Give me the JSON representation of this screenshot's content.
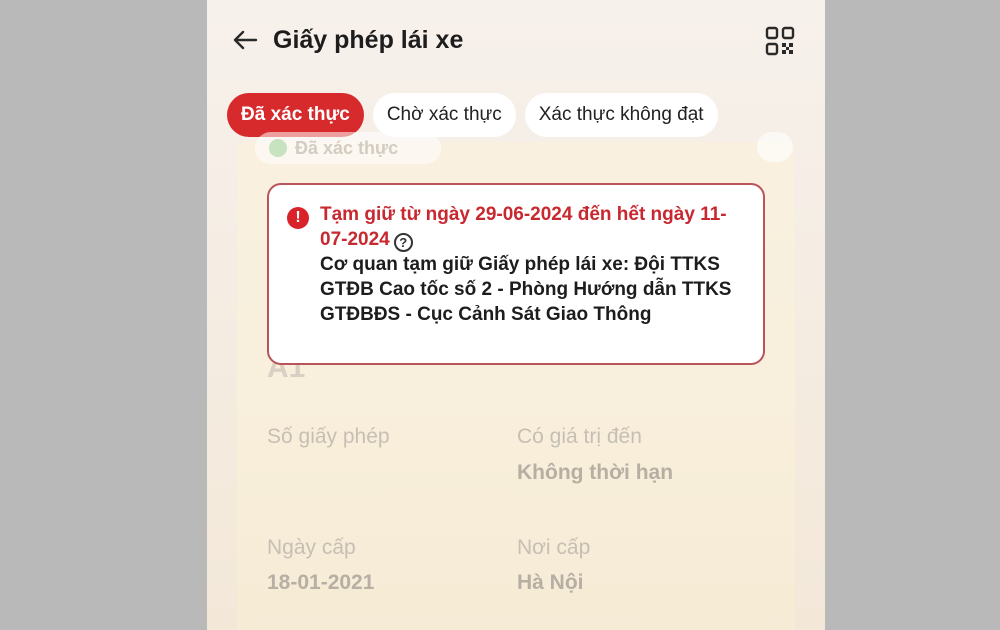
{
  "header": {
    "title": "Giấy phép lái xe",
    "back_icon": "arrow-left-icon",
    "qr_icon": "qr-code-icon"
  },
  "tabs": [
    {
      "label": "Đã xác thực",
      "active": true
    },
    {
      "label": "Chờ xác thực",
      "active": false
    },
    {
      "label": "Xác thực không đạt",
      "active": false
    }
  ],
  "card": {
    "status_pill": "Đã xác thực",
    "license_class": "A1",
    "fields": {
      "license_number_label": "Số giấy phép",
      "license_number_value": "",
      "valid_until_label": "Có giá trị đến",
      "valid_until_value": "Không thời hạn",
      "issue_date_label": "Ngày cấp",
      "issue_date_value": "18-01-2021",
      "issue_place_label": "Nơi cấp",
      "issue_place_value": "Hà Nội"
    }
  },
  "alert": {
    "title": "Tạm giữ từ ngày 29-06-2024 đến hết ngày 11-07-2024",
    "body": "Cơ quan tạm giữ Giấy phép lái xe: Đội TTKS GTĐB Cao tốc số 2 - Phòng Hướng dẫn TTKS GTĐBĐS - Cục Cảnh Sát Giao Thông",
    "icon": "exclamation-icon",
    "help_icon": "question-circle-icon",
    "accent_color": "#c8282f",
    "border_color": "#b9545a"
  },
  "colors": {
    "active_tab": "#d72a2d",
    "background": "#b9b9b9"
  }
}
